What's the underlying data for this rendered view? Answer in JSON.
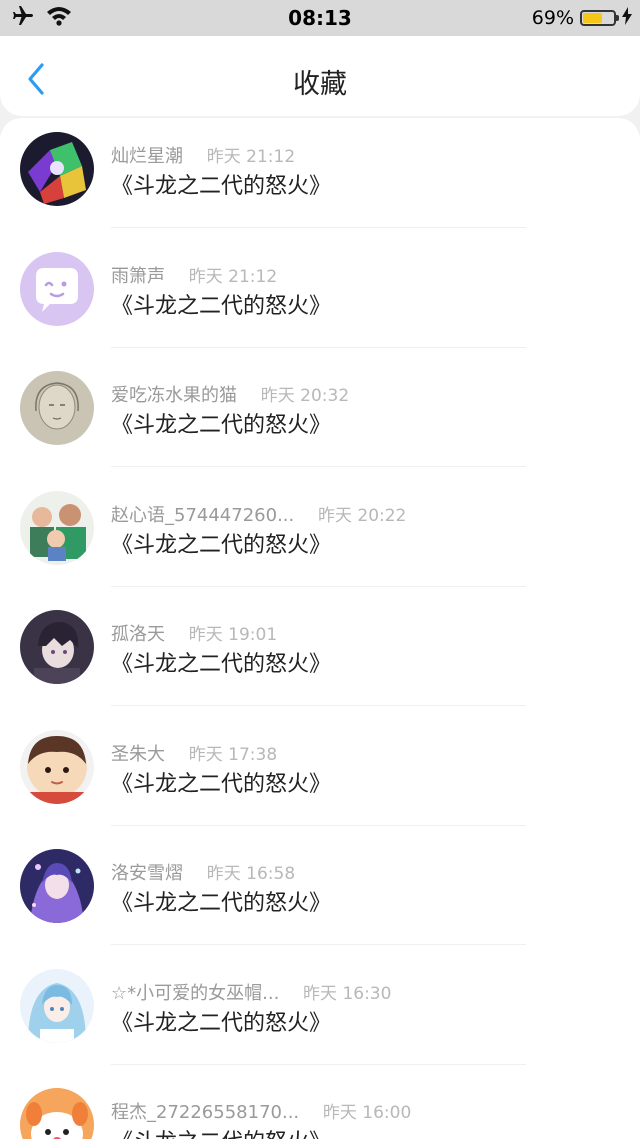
{
  "status_bar": {
    "time": "08:13",
    "battery_text": "69%",
    "battery_level": 0.69,
    "icons": [
      "airplane-icon",
      "wifi-icon",
      "battery-icon",
      "charging-bolt-icon"
    ]
  },
  "nav": {
    "title": "收藏",
    "back_icon": "chevron-left-icon"
  },
  "colors": {
    "accent": "#2b9cf2",
    "battery": "#f5c518",
    "name_text": "#9a9a9a",
    "time_text": "#b8b8b8"
  },
  "items": [
    {
      "name": "灿烂星潮",
      "time": "昨天 21:12",
      "message": "《斗龙之二代的怒火》",
      "avatar": "robot-anime-avatar"
    },
    {
      "name": "雨箫声",
      "time": "昨天 21:12",
      "message": "《斗龙之二代的怒火》",
      "avatar": "purple-chat-bubble-avatar"
    },
    {
      "name": "爱吃冻水果的猫",
      "time": "昨天 20:32",
      "message": "《斗龙之二代的怒火》",
      "avatar": "sketch-girl-avatar"
    },
    {
      "name": "赵心语_574447260...",
      "time": "昨天 20:22",
      "message": "《斗龙之二代的怒火》",
      "avatar": "family-photo-avatar"
    },
    {
      "name": "孤洛天",
      "time": "昨天 19:01",
      "message": "《斗龙之二代的怒火》",
      "avatar": "dark-anime-boy-avatar"
    },
    {
      "name": "圣朱大",
      "time": "昨天 17:38",
      "message": "《斗龙之二代的怒火》",
      "avatar": "cartoon-boy-avatar"
    },
    {
      "name": "洛安雪熠",
      "time": "昨天 16:58",
      "message": "《斗龙之二代的怒火》",
      "avatar": "anime-girl-purple-avatar"
    },
    {
      "name": "☆*小可爱的女巫帽...",
      "time": "昨天 16:30",
      "message": "《斗龙之二代的怒火》",
      "avatar": "anime-girl-blue-hair-avatar"
    },
    {
      "name": "程杰_27226558170...",
      "time": "昨天 16:00",
      "message": "《斗龙之二代的怒火》",
      "avatar": "cartoon-dog-avatar"
    }
  ]
}
